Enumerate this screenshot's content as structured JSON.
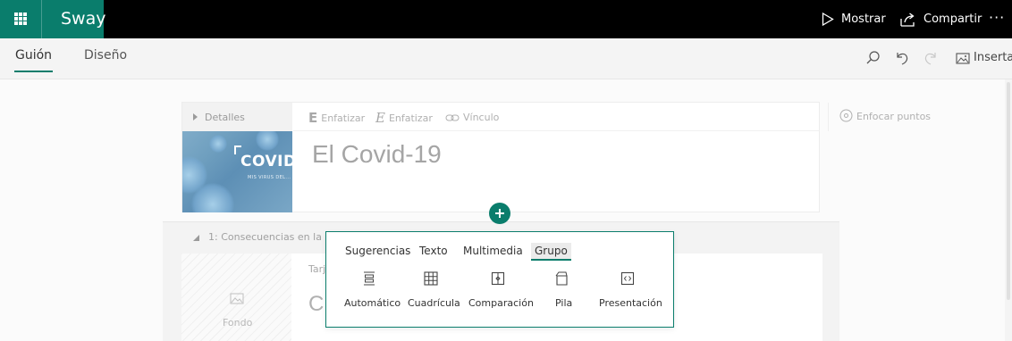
{
  "app": {
    "name": "Sway",
    "accent_color": "#0a7d6c"
  },
  "topbar": {
    "show_label": "Mostrar",
    "share_label": "Compartir",
    "more_label": "···"
  },
  "subbar": {
    "tabs": [
      {
        "label": "Guión",
        "active": true
      },
      {
        "label": "Diseño",
        "active": false
      }
    ],
    "insert_label": "Insertar"
  },
  "title_card": {
    "details_label": "Detalles",
    "image_text": "COVID",
    "image_subtext": "MIS VIRUS DEL...",
    "bold_label": "Enfatizar",
    "italic_label": "Enfatizar",
    "link_label": "Vínculo",
    "focus_label": "Enfocar puntos",
    "title": "El Covid-19"
  },
  "section": {
    "heading": "1: Consecuencias en la cor",
    "background_label": "Fondo",
    "card_type_label": "Tarj",
    "card_text": "C"
  },
  "insert_popup": {
    "tabs": [
      {
        "label": "Sugerencias",
        "active": false
      },
      {
        "label": "Texto",
        "active": false
      },
      {
        "label": "Multimedia",
        "active": false
      },
      {
        "label": "Grupo",
        "active": true
      }
    ],
    "options": [
      {
        "label": "Automático",
        "icon": "automatic-group-icon"
      },
      {
        "label": "Cuadrícula",
        "icon": "grid-group-icon"
      },
      {
        "label": "Comparación",
        "icon": "comparison-group-icon"
      },
      {
        "label": "Pila",
        "icon": "stack-group-icon"
      },
      {
        "label": "Presentación",
        "icon": "slideshow-group-icon"
      }
    ]
  }
}
